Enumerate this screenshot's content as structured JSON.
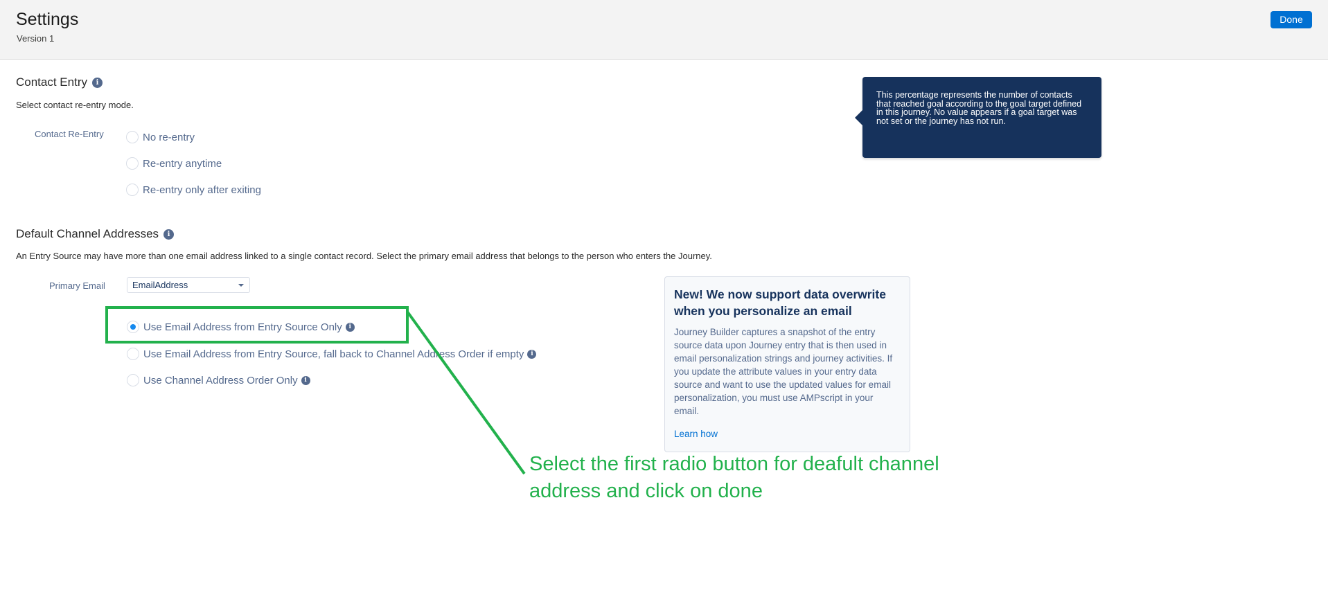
{
  "header": {
    "title": "Settings",
    "version": "Version 1",
    "done_label": "Done"
  },
  "contact_entry": {
    "heading": "Contact Entry",
    "heading_icon": "info-icon",
    "description": "Select contact re-entry mode.",
    "field_label": "Contact Re-Entry",
    "options": [
      {
        "label": "No re-entry",
        "checked": false
      },
      {
        "label": "Re-entry anytime",
        "checked": false
      },
      {
        "label": "Re-entry only after exiting",
        "checked": false
      }
    ]
  },
  "tooltip": {
    "text": "This percentage represents the number of contacts that reached goal according to the goal target defined in this journey. No value appears if a goal target was not set or the journey has not run."
  },
  "default_channel": {
    "heading": "Default Channel Addresses",
    "heading_icon": "info-icon",
    "description": "An Entry Source may have more than one email address linked to a single contact record. Select the primary email address that belongs to the person who enters the Journey.",
    "primary_email_label": "Primary Email",
    "primary_email_value": "EmailAddress",
    "options": [
      {
        "label": "Use Email Address from Entry Source Only",
        "checked": true,
        "icon": "info-icon"
      },
      {
        "label": "Use Email Address from Entry Source, fall back to Channel Address Order if empty",
        "checked": false,
        "icon": "info-icon"
      },
      {
        "label": "Use Channel Address Order Only",
        "checked": false,
        "icon": "info-icon"
      }
    ]
  },
  "notice": {
    "title": "New! We now support data overwrite when you personalize an email",
    "body": "Journey Builder captures a snapshot of the entry source data upon Journey entry that is then used in email personalization strings and journey activities. If you update the attribute values in your entry data source and want to use the updated values for email personalization, you must use AMPscript in your email.",
    "link": "Learn how"
  },
  "annotation": {
    "text": "Select the first radio button for deafult channel address and click on done",
    "color": "#22b14c"
  },
  "colors": {
    "accent": "#0070d2",
    "tooltip_bg": "#16325c",
    "label": "#54698d"
  }
}
